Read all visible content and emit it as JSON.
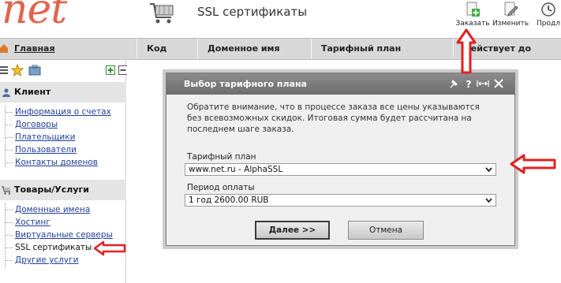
{
  "header": {
    "logo": "net",
    "page_title": "SSL сертификаты",
    "tools": [
      {
        "label": "Заказать",
        "icon": "add-document-icon"
      },
      {
        "label": "Изменить",
        "icon": "edit-document-icon"
      },
      {
        "label": "Продл",
        "icon": "clock-icon"
      }
    ]
  },
  "grid": {
    "home_link": "Главная",
    "columns": [
      "Код",
      "Доменное имя",
      "Тарифный план",
      "Действует до"
    ]
  },
  "sidebar": {
    "groups": [
      {
        "title": "Клиент",
        "items": [
          "Информация о счетах",
          "Договоры",
          "Плательщики",
          "Пользователи",
          "Контакты доменов"
        ]
      },
      {
        "title": "Товары/Услуги",
        "items": [
          "Доменные имена",
          "Хостинг",
          "Виртуальные серверы",
          "SSL сертификаты",
          "Другие услуги"
        ]
      }
    ]
  },
  "modal": {
    "title": "Выбор тарифного плана",
    "notice": "Обратите внимание, что в процессе заказа все цены указываются без всевозможных скидок. Итоговая сумма будет рассчитана на последнем шаге заказа.",
    "tariff_label": "Тарифный план",
    "tariff_value": "www.net.ru - AlphaSSL",
    "period_label": "Период оплаты",
    "period_value": "1 год 2600.00 RUB",
    "next_button": "Далее >>",
    "cancel_button": "Отмена"
  },
  "colors": {
    "logo": "#e2634f",
    "annotation_arrow": "#e02020",
    "modal_title_bar": "#7a7a7a",
    "link": "#1f3f9a"
  }
}
